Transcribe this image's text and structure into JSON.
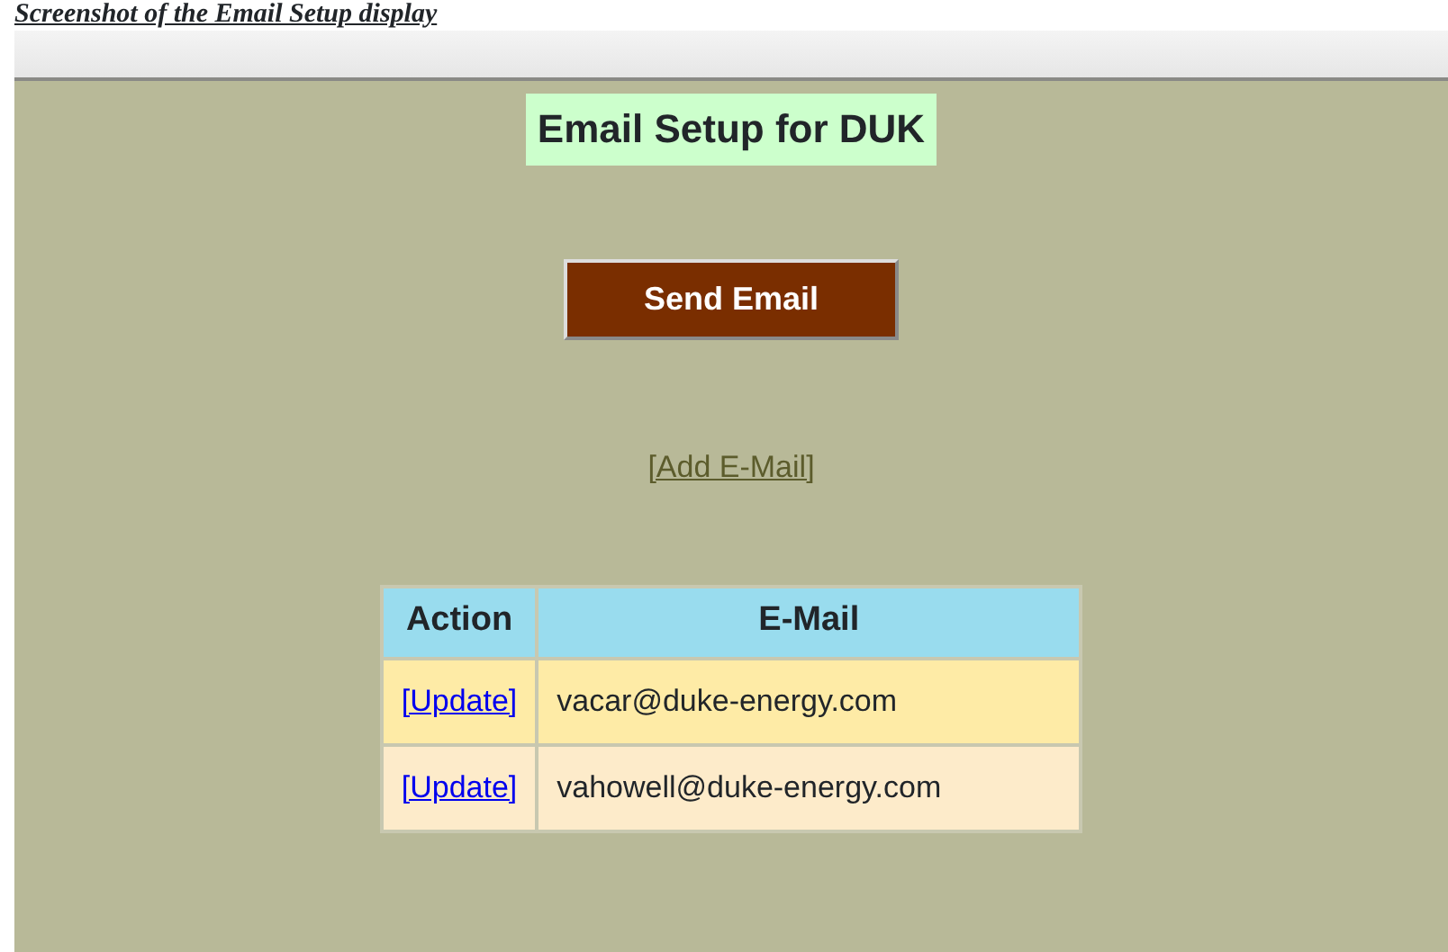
{
  "caption": "Screenshot of the Email Setup display",
  "page": {
    "title": "Email Setup for DUK",
    "send_button": "Send Email",
    "add_link": "[Add E-Mail]"
  },
  "table": {
    "columns": [
      "Action",
      "E-Mail"
    ],
    "rows": [
      {
        "action": "[Update]",
        "email": "vacar@duke-energy.com"
      },
      {
        "action": "[Update]",
        "email": "vahowell@duke-energy.com"
      }
    ]
  }
}
